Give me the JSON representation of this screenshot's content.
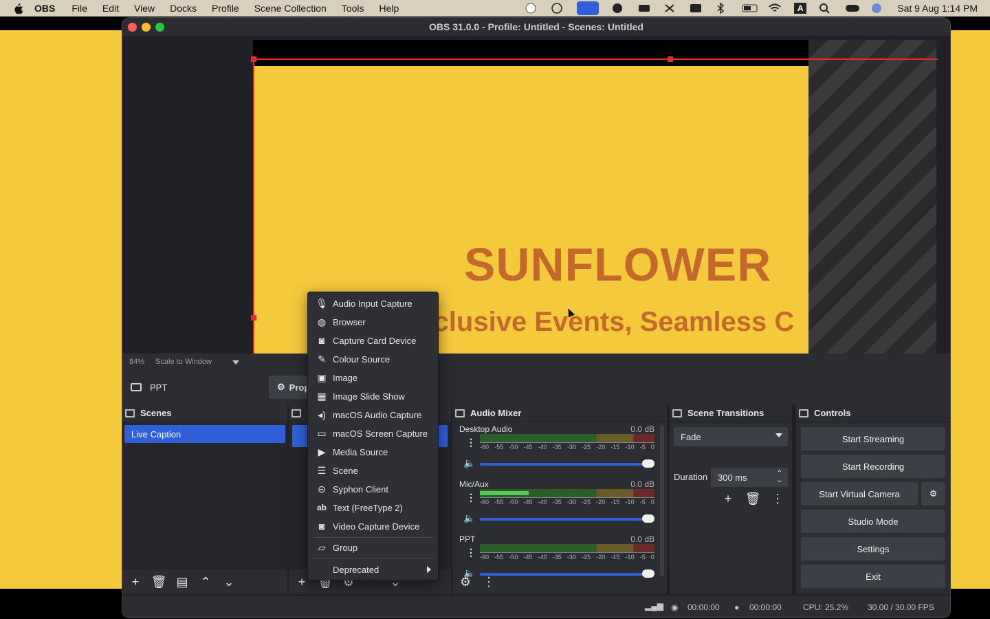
{
  "menubar": {
    "app": "OBS",
    "items": [
      "File",
      "Edit",
      "View",
      "Docks",
      "Profile",
      "Scene Collection",
      "Tools",
      "Help"
    ],
    "clock": "Sat 9 Aug  1:14 PM",
    "status_icons": [
      "record-icon",
      "timer-icon",
      "screen-share-icon",
      "chat-icon",
      "battery-widget-icon",
      "expand-icon",
      "photo-icon",
      "bluetooth-icon",
      "battery-icon",
      "wifi-icon",
      "input-source-icon",
      "search-icon",
      "control-center-icon",
      "siri-icon"
    ],
    "input_source_label": "A"
  },
  "window": {
    "title": "OBS 31.0.0 - Profile: Untitled - Scenes: Untitled"
  },
  "preview": {
    "headline": "SUNFLOWER",
    "tagline": "Inclusive Events, Seamless C",
    "zoom": "84%",
    "scale_mode": "Scale to Window"
  },
  "sourcebar": {
    "selected_source": "PPT",
    "properties_label": "Prop"
  },
  "scenes": {
    "title": "Scenes",
    "items": [
      "Live Caption"
    ]
  },
  "sources": {
    "title": "S"
  },
  "context_menu": {
    "items": [
      {
        "label": "Audio Input Capture",
        "icon": "microphone-icon"
      },
      {
        "label": "Browser",
        "icon": "globe-icon"
      },
      {
        "label": "Capture Card Device",
        "icon": "camera-icon"
      },
      {
        "label": "Colour Source",
        "icon": "brush-icon"
      },
      {
        "label": "Image",
        "icon": "image-icon"
      },
      {
        "label": "Image Slide Show",
        "icon": "slideshow-icon"
      },
      {
        "label": "macOS Audio Capture",
        "icon": "speaker-icon"
      },
      {
        "label": "macOS Screen Capture",
        "icon": "monitor-icon"
      },
      {
        "label": "Media Source",
        "icon": "play-icon"
      },
      {
        "label": "Scene",
        "icon": "list-icon"
      },
      {
        "label": "Syphon Client",
        "icon": "syphon-icon"
      },
      {
        "label": "Text (FreeType 2)",
        "icon": "text-icon"
      },
      {
        "label": "Video Capture Device",
        "icon": "camera-icon"
      }
    ],
    "group": {
      "label": "Group",
      "icon": "folder-icon"
    },
    "deprecated": "Deprecated",
    "text_icon_glyph": "ab"
  },
  "mixer": {
    "title": "Audio Mixer",
    "channels": [
      {
        "name": "Desktop Audio",
        "db": "0.0 dB",
        "level": 0,
        "volume": 1.0
      },
      {
        "name": "Mic/Aux",
        "db": "0.0 dB",
        "level": 0.28,
        "volume": 1.0
      },
      {
        "name": "PPT",
        "db": "0.0 dB",
        "level": 0,
        "volume": 1.0
      }
    ],
    "scale": [
      "-60",
      "-55",
      "-50",
      "-45",
      "-40",
      "-35",
      "-30",
      "-25",
      "-20",
      "-15",
      "-10",
      "-5",
      "0"
    ]
  },
  "transitions": {
    "title": "Scene Transitions",
    "selected": "Fade",
    "duration_label": "Duration",
    "duration_value": "300 ms"
  },
  "controls": {
    "title": "Controls",
    "start_streaming": "Start Streaming",
    "start_recording": "Start Recording",
    "start_virtual_camera": "Start Virtual Camera",
    "studio_mode": "Studio Mode",
    "settings": "Settings",
    "exit": "Exit"
  },
  "status": {
    "stream_time": "00:00:00",
    "record_time": "00:00:00",
    "cpu": "CPU: 25.2%",
    "fps": "30.00 / 30.00 FPS"
  },
  "colors": {
    "accent_blue": "#2f60d9",
    "brand_yellow": "#f5c93c",
    "headline_orange": "#c4692e",
    "selection_red": "#e0302e"
  }
}
